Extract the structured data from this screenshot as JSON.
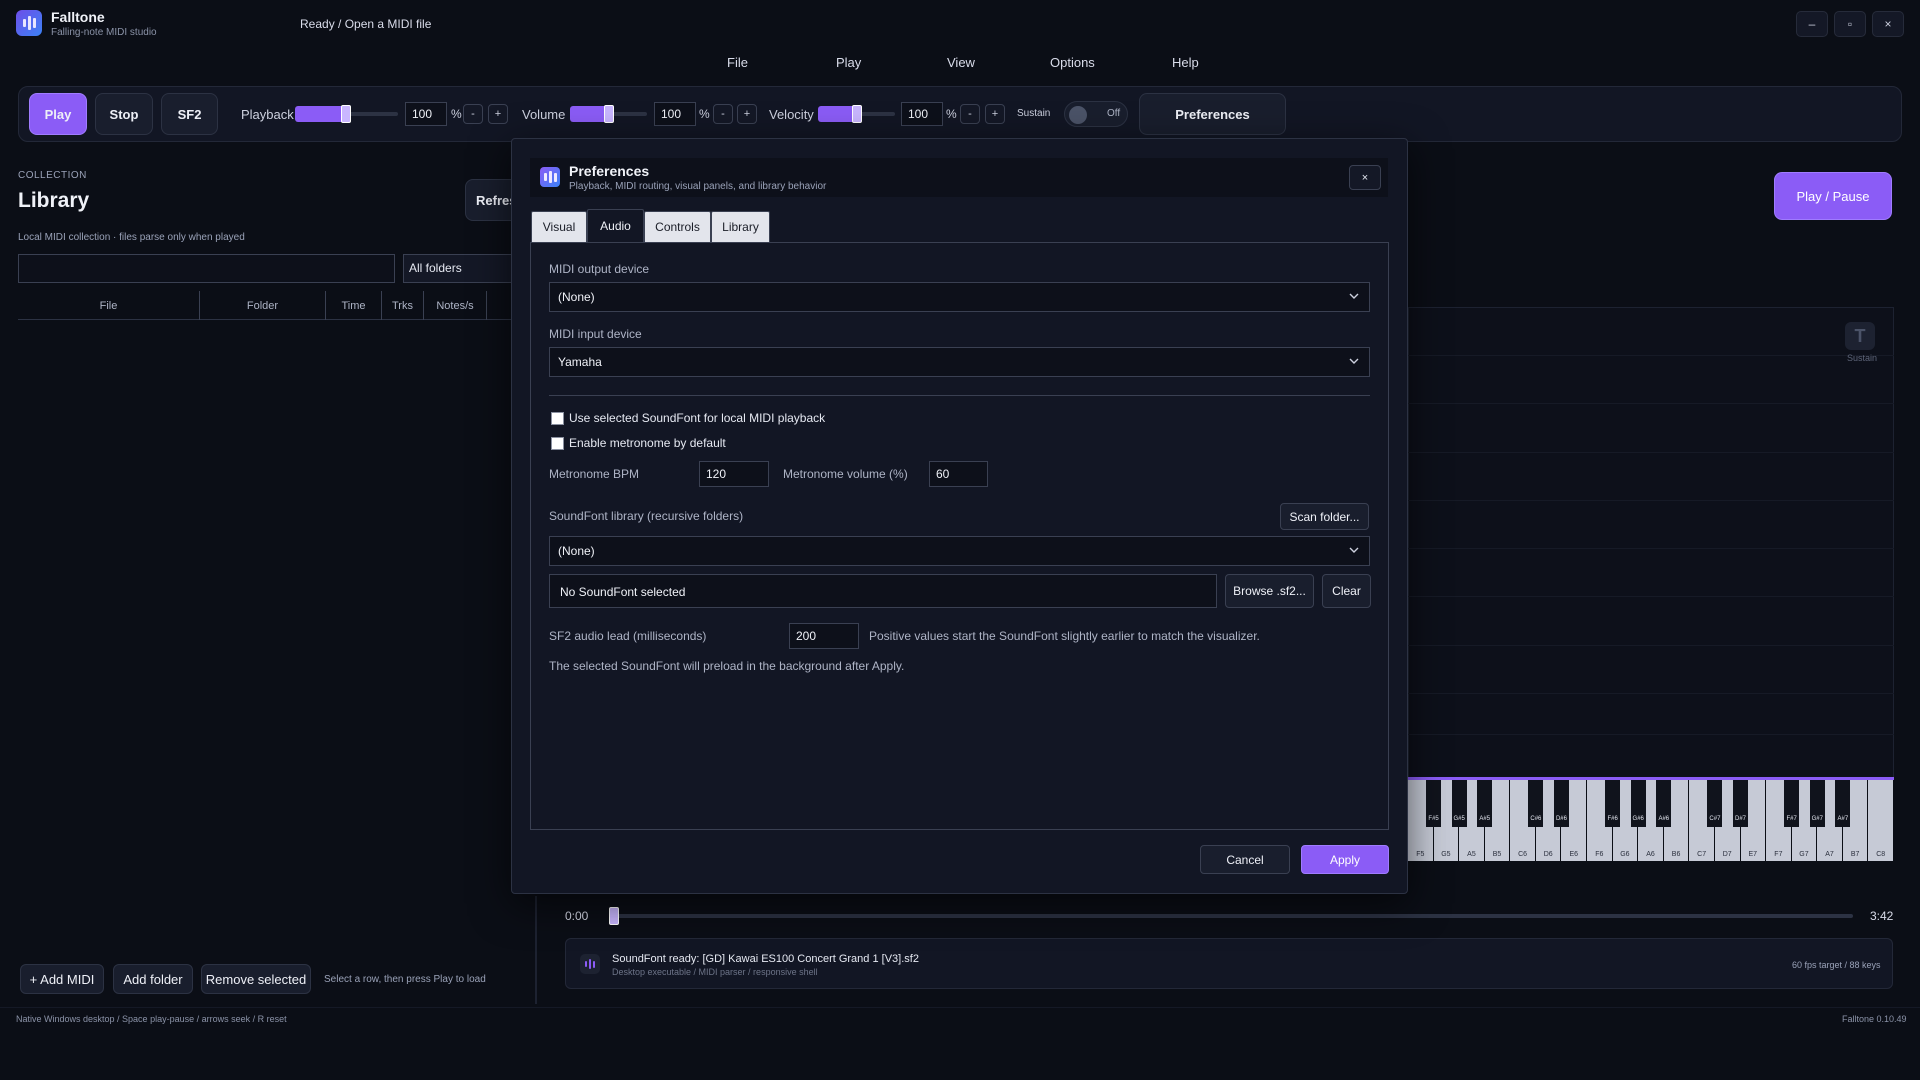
{
  "app": {
    "name": "Falltone",
    "subtitle": "Falling-note MIDI studio",
    "status": "Ready / Open a MIDI file",
    "window_buttons": {
      "minimize": "–",
      "maximize": "▫",
      "close": "×"
    }
  },
  "menu": [
    "File",
    "Play",
    "View",
    "Options",
    "Help"
  ],
  "toolbar": {
    "play": "Play",
    "stop": "Stop",
    "sf2": "SF2",
    "playback_label": "Playback",
    "playback_value": "100",
    "volume_label": "Volume",
    "volume_value": "100",
    "velocity_label": "Velocity",
    "velocity_value": "100",
    "percent": "%",
    "minus": "-",
    "plus": "+",
    "sustain_label": "Sustain",
    "sustain_state": "Off",
    "preferences": "Preferences",
    "levels": {
      "playback": 0.5,
      "volume": 0.5,
      "velocity": 0.5
    }
  },
  "library": {
    "overline": "COLLECTION",
    "title": "Library",
    "refresh": "Refresh",
    "description": "Local MIDI collection · files parse only when played",
    "search_value": "",
    "folder_filter": "All folders",
    "columns": [
      "File",
      "Folder",
      "Time",
      "Trks",
      "Notes/s"
    ],
    "add_midi": "+ Add MIDI",
    "add_folder": "Add folder",
    "remove_selected": "Remove selected",
    "hint": "Select a row, then press Play to load"
  },
  "player": {
    "play_pause": "Play / Pause",
    "sustain_icon": "T",
    "sustain_label": "Sustain",
    "time_start": "0:00",
    "time_end": "3:42",
    "white_keys": [
      "F5",
      "G5",
      "A5",
      "B5",
      "C6",
      "D6",
      "E6",
      "F6",
      "G6",
      "A6",
      "B6",
      "C7",
      "D7",
      "E7",
      "F7",
      "G7",
      "A7",
      "B7",
      "C8"
    ],
    "black_keys": [
      "F#5",
      "G#5",
      "A#5",
      "C#6",
      "D#6",
      "F#6",
      "G#6",
      "A#6",
      "C#7",
      "D#7",
      "F#7",
      "G#7",
      "A#7"
    ],
    "info_title": "SoundFont ready: [GD] Kawai ES100 Concert Grand 1 [V3].sf2",
    "info_sub": "Desktop executable / MIDI parser / responsive shell",
    "info_stats": "60 fps target / 88 keys"
  },
  "footer": {
    "left": "Native Windows desktop / Space play-pause / arrows seek / R reset",
    "right": "Falltone 0.10.49"
  },
  "dialog": {
    "title": "Preferences",
    "subtitle": "Playback, MIDI routing, visual panels, and library behavior",
    "close": "×",
    "tabs": [
      "Visual",
      "Audio",
      "Controls",
      "Library"
    ],
    "active_tab": "Audio",
    "midi_output_label": "MIDI output device",
    "midi_output_value": "(None)",
    "midi_input_label": "MIDI input device",
    "midi_input_value": "Yamaha",
    "use_soundfont_label": "Use selected SoundFont for local MIDI playback",
    "use_soundfont_checked": false,
    "metronome_default_label": "Enable metronome by default",
    "metronome_default_checked": false,
    "metronome_bpm_label": "Metronome BPM",
    "metronome_bpm_value": "120",
    "metronome_volume_label": "Metronome volume (%)",
    "metronome_volume_value": "60",
    "sf_library_label": "SoundFont library (recursive folders)",
    "scan_folder": "Scan folder...",
    "sf_library_value": "(None)",
    "sf_selected_text": "No SoundFont selected",
    "browse_sf2": "Browse .sf2...",
    "clear": "Clear",
    "sf2_lead_label": "SF2 audio lead (milliseconds)",
    "sf2_lead_value": "200",
    "sf2_lead_hint": "Positive values start the SoundFont slightly earlier to match the visualizer.",
    "preload_note": "The selected SoundFont will preload in the background after Apply.",
    "cancel": "Cancel",
    "apply": "Apply"
  },
  "colors": {
    "accent": "#8b5cf6",
    "background": "#0b0e16",
    "panel": "#121624"
  }
}
